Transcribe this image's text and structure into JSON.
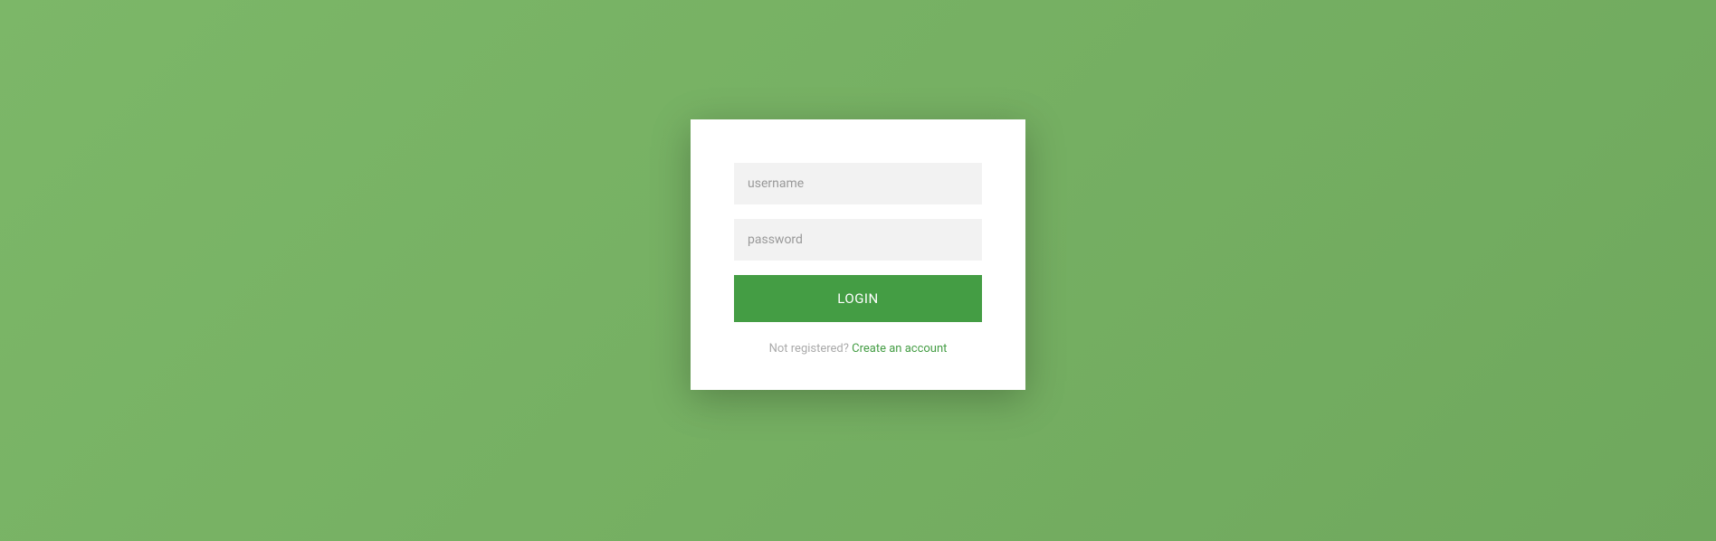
{
  "form": {
    "username": {
      "placeholder": "username",
      "value": ""
    },
    "password": {
      "placeholder": "password",
      "value": ""
    },
    "submit_label": "LOGIN",
    "register_prompt": "Not registered? ",
    "register_link_text": "Create an account"
  }
}
